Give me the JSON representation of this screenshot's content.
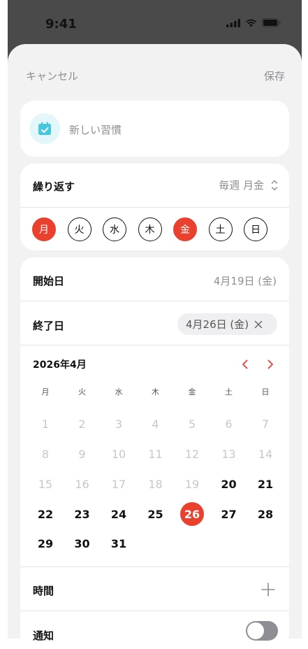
{
  "status_bar": {
    "time": "9:41"
  },
  "nav": {
    "cancel": "キャンセル",
    "save": "保存"
  },
  "title_field": {
    "placeholder": "新しい習慣",
    "icon": "calendar-check-icon",
    "icon_color": "#45c7dc"
  },
  "repeat": {
    "label": "繰り返す",
    "value": "毎週 月金",
    "days": [
      {
        "label": "月",
        "selected": true
      },
      {
        "label": "火",
        "selected": false
      },
      {
        "label": "水",
        "selected": false
      },
      {
        "label": "木",
        "selected": false
      },
      {
        "label": "金",
        "selected": true
      },
      {
        "label": "土",
        "selected": false
      },
      {
        "label": "日",
        "selected": false
      }
    ]
  },
  "dates": {
    "start_label": "開始日",
    "start_value": "4月19日 (金)",
    "end_label": "終了日",
    "end_value": "4月26日 (金)"
  },
  "calendar": {
    "month_label": "2026年4月",
    "weekdays": [
      "月",
      "火",
      "水",
      "木",
      "金",
      "土",
      "日"
    ],
    "weeks": [
      [
        "1",
        "2",
        "3",
        "4",
        "5",
        "6",
        "7"
      ],
      [
        "8",
        "9",
        "10",
        "11",
        "12",
        "13",
        "14"
      ],
      [
        "15",
        "16",
        "17",
        "18",
        "19",
        "20",
        "21"
      ],
      [
        "22",
        "23",
        "24",
        "25",
        "26",
        "27",
        "28"
      ],
      [
        "29",
        "30",
        "31",
        "",
        "",
        "",
        ""
      ]
    ],
    "past_through": 19,
    "selected": 26
  },
  "time_row": {
    "label": "時間"
  },
  "notify_row": {
    "label": "通知",
    "enabled": false
  },
  "colors": {
    "accent": "#e9412e",
    "muted": "#8e8e93"
  }
}
